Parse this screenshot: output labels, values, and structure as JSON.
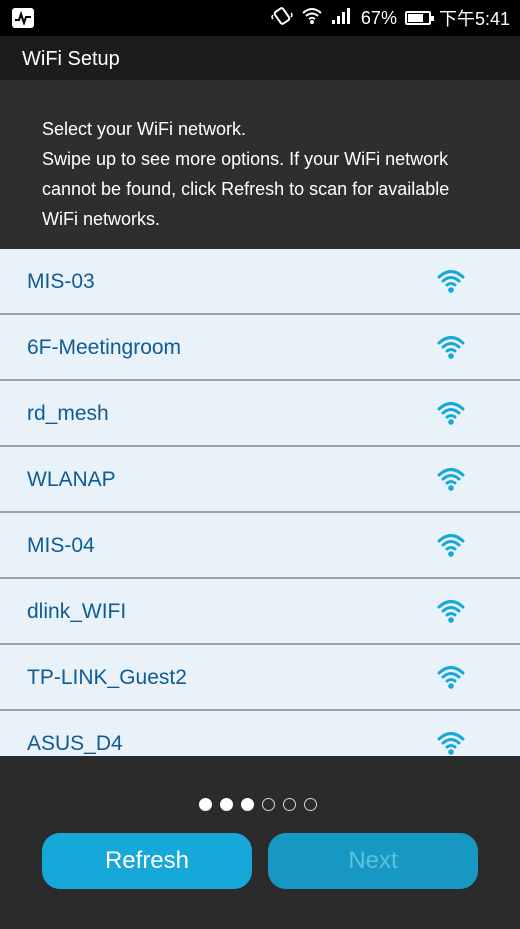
{
  "status_bar": {
    "app_icon": "activity-monitor-icon",
    "battery_percent": "67%",
    "battery_level": 0.67,
    "time": "下午5:41",
    "icons": [
      "vibrate-icon",
      "wifi-status-icon",
      "signal-bars-icon",
      "battery-icon"
    ]
  },
  "header": {
    "title": "WiFi Setup"
  },
  "instructions": {
    "line1": "Select your WiFi network.",
    "line2": "Swipe up to see more options. If your WiFi network cannot be found, click Refresh to scan for available WiFi networks."
  },
  "networks": [
    {
      "name": "MIS-03",
      "icon": "wifi-signal-icon"
    },
    {
      "name": "6F-Meetingroom",
      "icon": "wifi-signal-icon"
    },
    {
      "name": "rd_mesh",
      "icon": "wifi-signal-icon"
    },
    {
      "name": "WLANAP",
      "icon": "wifi-signal-icon"
    },
    {
      "name": "MIS-04",
      "icon": "wifi-signal-icon"
    },
    {
      "name": "dlink_WIFI",
      "icon": "wifi-signal-icon"
    },
    {
      "name": "TP-LINK_Guest2",
      "icon": "wifi-signal-icon"
    },
    {
      "name": "ASUS_D4",
      "icon": "wifi-signal-icon"
    }
  ],
  "pager": {
    "current_page": 3,
    "total_pages": 6
  },
  "buttons": {
    "refresh": "Refresh",
    "next": "Next"
  },
  "colors": {
    "network_text": "#0f5c94",
    "button": "#16a8d9",
    "list_bg": "#e9f1f9"
  }
}
